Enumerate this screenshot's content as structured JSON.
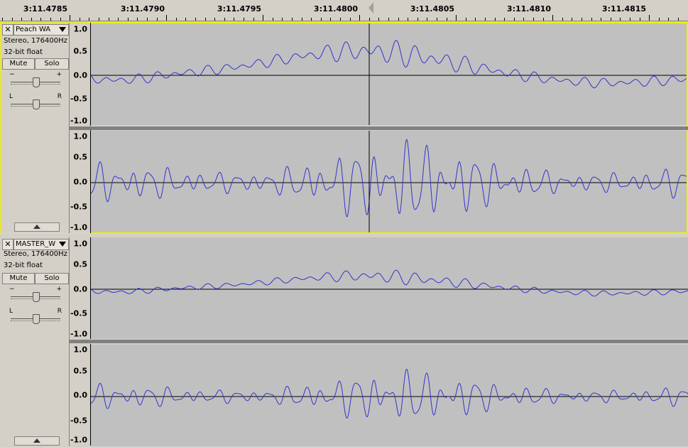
{
  "ruler": {
    "labels": [
      "3:11.4785",
      "3:11.4790",
      "3:11.4795",
      "3:11.4800",
      "3:11.4805",
      "3:11.4810",
      "3:11.4815"
    ]
  },
  "tracks": [
    {
      "name": "Peach WA",
      "format": "Stereo, 176400Hz",
      "bitdepth": "32-bit float",
      "mute": "Mute",
      "solo": "Solo",
      "gain_minus": "−",
      "gain_plus": "+",
      "pan_l": "L",
      "pan_r": "R",
      "scale_top": [
        "1.0",
        "0.5",
        "0.0",
        "-0.5",
        "-1.0"
      ],
      "scale_bottom": [
        "1.0",
        "0.5",
        "0.0",
        "-0.5",
        "-1.0"
      ]
    },
    {
      "name": "MASTER_W",
      "format": "Stereo, 176400Hz",
      "bitdepth": "32-bit float",
      "mute": "Mute",
      "solo": "Solo",
      "gain_minus": "−",
      "gain_plus": "+",
      "pan_l": "L",
      "pan_r": "R",
      "scale_top": [
        "1.0",
        "0.5",
        "0.0",
        "-0.5",
        "-1.0"
      ],
      "scale_bottom": [
        "1.0",
        "0.5",
        "0.0",
        "-0.5",
        "-1.0"
      ]
    }
  ],
  "colors": {
    "waveform": "#3333cc",
    "selection_outline": "#f0f000",
    "background": "#c0c0c0"
  },
  "icons": {
    "close": "close-icon",
    "menu": "dropdown-arrow-icon",
    "collapse": "collapse-up-icon"
  }
}
